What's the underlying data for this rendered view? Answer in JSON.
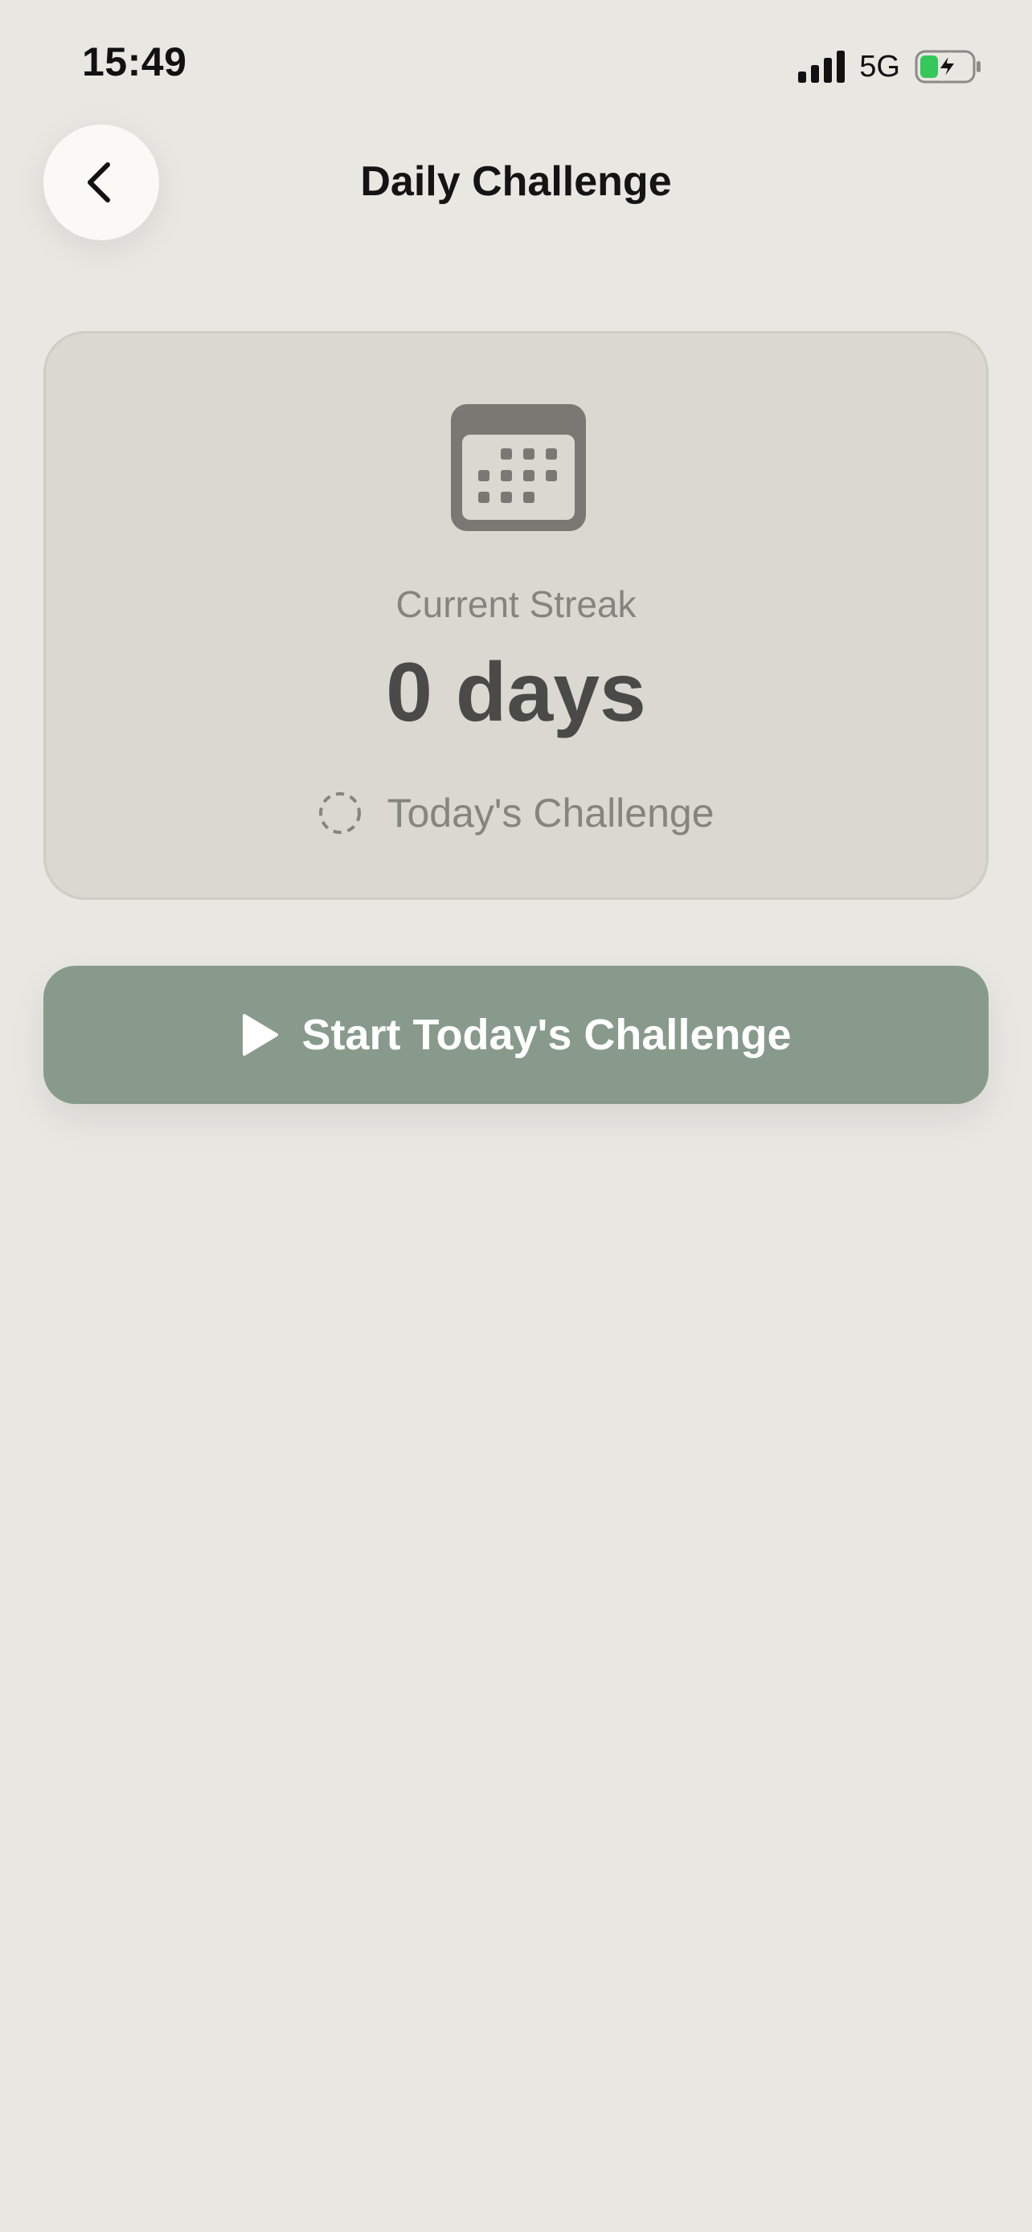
{
  "status_bar": {
    "time": "15:49",
    "network": "5G",
    "signal_icon": "cellular-signal-icon",
    "battery_icon": "battery-charging-icon",
    "battery_fill_color": "#35C759"
  },
  "header": {
    "back_icon": "chevron-left-icon",
    "title": "Daily Challenge"
  },
  "streak_card": {
    "icon": "calendar-icon",
    "label": "Current Streak",
    "value": "0 days",
    "today_icon": "dashed-circle-icon",
    "today_label": "Today's Challenge"
  },
  "start_button": {
    "icon": "play-icon",
    "label": "Start Today's Challenge",
    "color": "#879A8C"
  }
}
